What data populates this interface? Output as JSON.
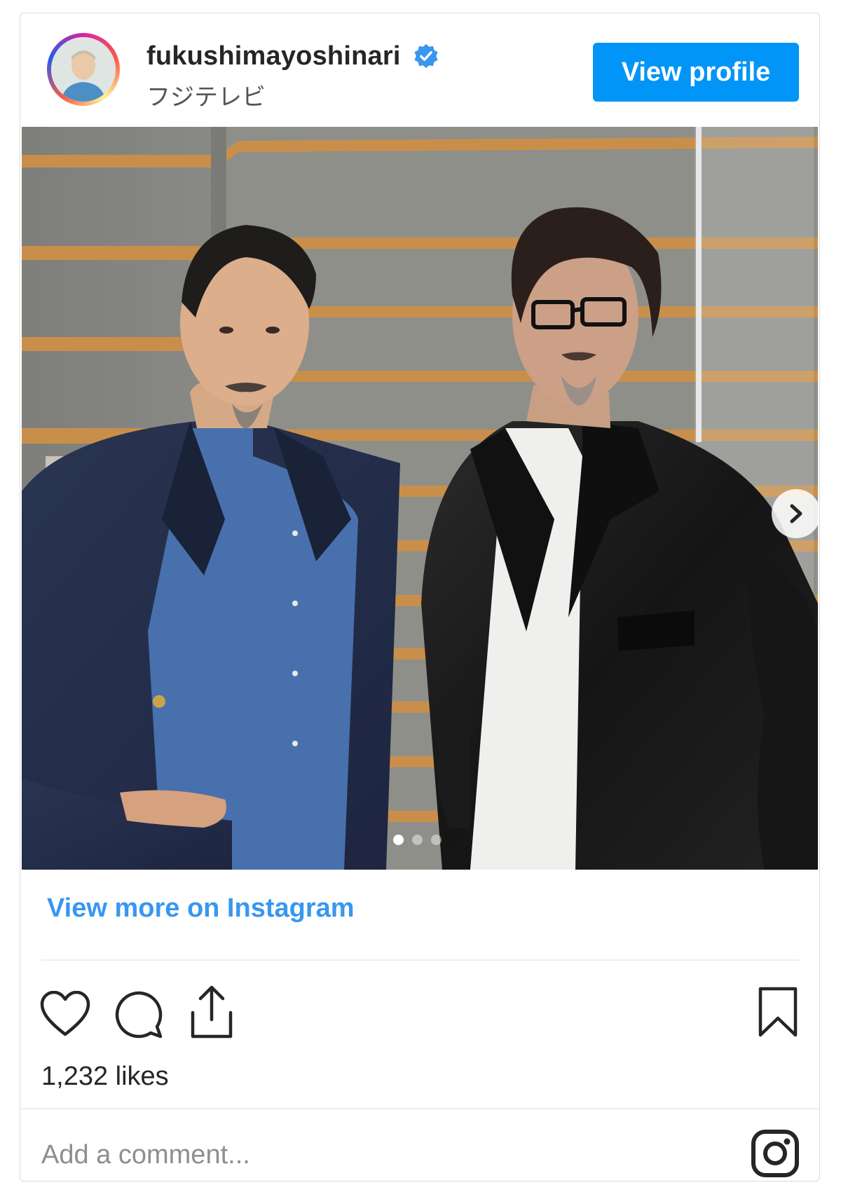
{
  "post": {
    "username": "fukushimayoshinari",
    "verified": true,
    "subtitle": "フジテレビ",
    "view_profile_label": "View profile",
    "view_more_label": "View more on Instagram",
    "likes_text": "1,232 likes",
    "comment_placeholder": "Add a comment...",
    "carousel": {
      "slide_count": 3,
      "active_index": 0
    }
  },
  "colors": {
    "accent": "#0095f6",
    "link": "#3897f0",
    "verified_badge": "#3897f0"
  },
  "icons": [
    "verified-icon",
    "heart-icon",
    "comment-icon",
    "share-icon",
    "bookmark-icon",
    "instagram-logo-icon",
    "chevron-right-icon"
  ]
}
